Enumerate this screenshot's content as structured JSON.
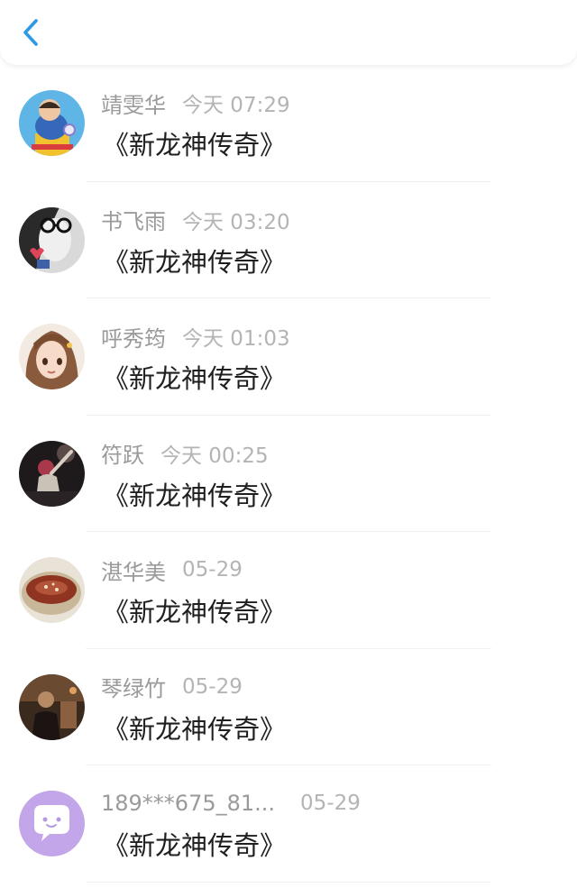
{
  "header": {
    "back_icon": "chevron-left-icon",
    "accent_color": "#2d9ae4"
  },
  "list": [
    {
      "name": "靖雯华",
      "time": "今天 07:29",
      "title": "《新龙神传奇》",
      "avatar": "cartoon-character-avatar"
    },
    {
      "name": "书飞雨",
      "time": "今天 03:20",
      "title": "《新龙神传奇》",
      "avatar": "girl-with-glasses-avatar"
    },
    {
      "name": "呼秀筠",
      "time": "今天 01:03",
      "title": "《新龙神传奇》",
      "avatar": "anime-girl-avatar"
    },
    {
      "name": "符跃",
      "time": "今天 00:25",
      "title": "《新龙神传奇》",
      "avatar": "night-photo-avatar"
    },
    {
      "name": "湛华美",
      "time": "05-29",
      "title": "《新龙神传奇》",
      "avatar": "soup-bowl-avatar"
    },
    {
      "name": "琴绿竹",
      "time": "05-29",
      "title": "《新龙神传奇》",
      "avatar": "dark-photo-avatar"
    },
    {
      "name": "189***675_81...",
      "time": "05-29",
      "title": "《新龙神传奇》",
      "avatar": "default-chat-avatar"
    }
  ]
}
